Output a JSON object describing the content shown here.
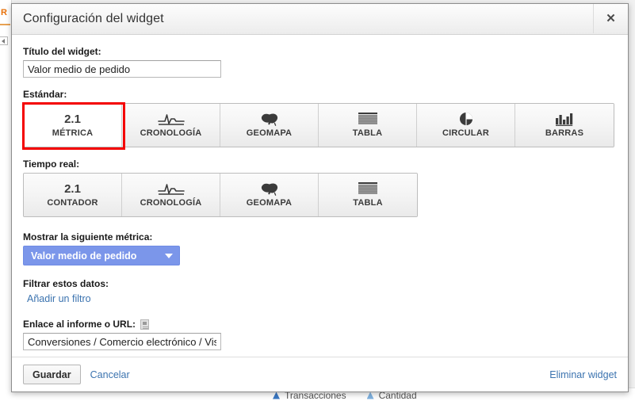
{
  "background": {
    "side_letter": "R",
    "legend": [
      {
        "label": "Transacciones",
        "color": "#3a78c3"
      },
      {
        "label": "Cantidad",
        "color": "#7fb2e0"
      }
    ]
  },
  "dialog": {
    "title": "Configuración del widget",
    "close_icon": "close-icon",
    "title_field": {
      "label": "Título del widget:",
      "value": "Valor medio de pedido",
      "placeholder": ""
    },
    "standard": {
      "label": "Estándar:",
      "selected_index": 0,
      "selection_highlight_color": "#f40000",
      "options": [
        {
          "label": "MÉTRICA",
          "icon": "number-2-1-icon",
          "glyph": "2.1",
          "name": "metric"
        },
        {
          "label": "CRONOLOGÍA",
          "icon": "timeline-icon",
          "glyph": "",
          "name": "timeline"
        },
        {
          "label": "GEOMAPA",
          "icon": "geomap-icon",
          "glyph": "",
          "name": "geomap"
        },
        {
          "label": "TABLA",
          "icon": "table-icon",
          "glyph": "",
          "name": "table"
        },
        {
          "label": "CIRCULAR",
          "icon": "pie-chart-icon",
          "glyph": "",
          "name": "pie"
        },
        {
          "label": "BARRAS",
          "icon": "bar-chart-icon",
          "glyph": "",
          "name": "bars"
        }
      ]
    },
    "realtime": {
      "label": "Tiempo real:",
      "selected_index": -1,
      "options": [
        {
          "label": "CONTADOR",
          "icon": "number-2-1-icon",
          "glyph": "2.1",
          "name": "counter"
        },
        {
          "label": "CRONOLOGÍA",
          "icon": "timeline-icon",
          "glyph": "",
          "name": "timeline"
        },
        {
          "label": "GEOMAPA",
          "icon": "geomap-icon",
          "glyph": "",
          "name": "geomap"
        },
        {
          "label": "TABLA",
          "icon": "table-icon",
          "glyph": "",
          "name": "table"
        }
      ]
    },
    "metric": {
      "label": "Mostrar la siguiente métrica:",
      "selected": "Valor medio de pedido",
      "accent_color": "#7b96ea",
      "caret_icon": "chevron-down-icon"
    },
    "filter": {
      "label": "Filtrar estos datos:",
      "add_link": "Añadir un filtro"
    },
    "url": {
      "label": "Enlace al informe o URL:",
      "help_icon": "help-document-icon",
      "value": "Conversiones / Comercio electrónico / Visión g",
      "placeholder": ""
    },
    "footer": {
      "save": "Guardar",
      "cancel": "Cancelar",
      "delete": "Eliminar widget",
      "link_color": "#3b73af"
    }
  }
}
